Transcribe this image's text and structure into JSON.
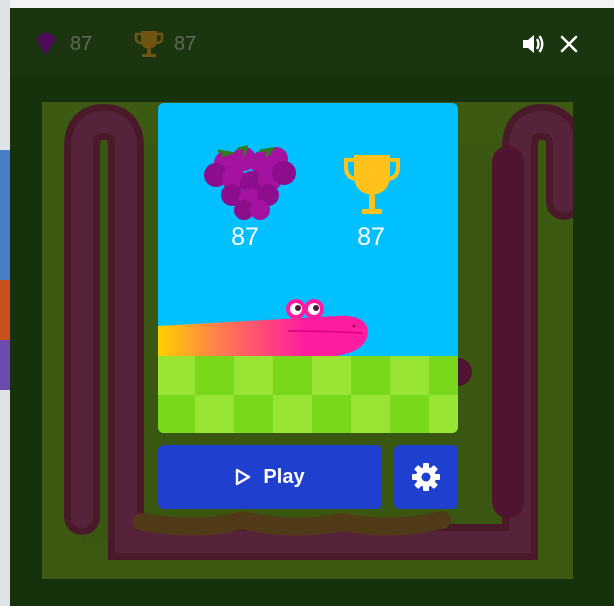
{
  "hud": {
    "apple_count": "87",
    "trophy_count": "87",
    "apple_icon": "purple-fruit-icon",
    "trophy_icon": "trophy-icon"
  },
  "card": {
    "score": "87",
    "best": "87"
  },
  "buttons": {
    "play_label": "Play",
    "settings_icon": "gear-icon",
    "sound_icon": "speaker-icon",
    "close_icon": "close-icon"
  },
  "colors": {
    "sky": "#00c0ff",
    "grass_light": "#98e432",
    "grass_dark": "#7ad81c",
    "snake": "#ff1c9f",
    "button": "#1f3fcf"
  }
}
